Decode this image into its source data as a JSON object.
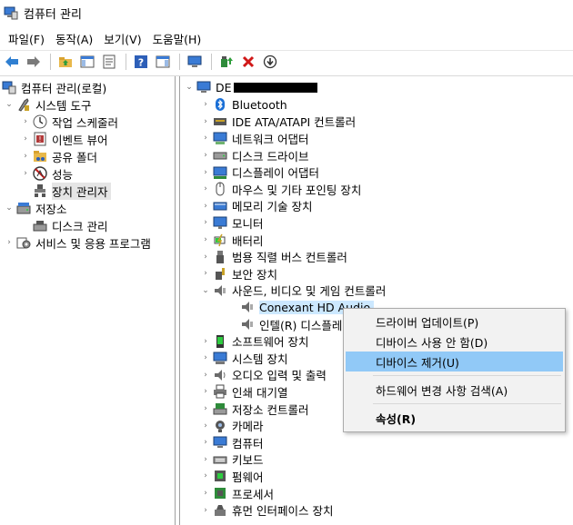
{
  "window": {
    "title": "컴퓨터 관리"
  },
  "menu": [
    "파일(F)",
    "동작(A)",
    "보기(V)",
    "도움말(H)"
  ],
  "left_tree": [
    {
      "label": "컴퓨터 관리(로컬)",
      "icon": "computer-management-icon",
      "level": 0,
      "arrow": ""
    },
    {
      "label": "시스템 도구",
      "icon": "system-tools-icon",
      "level": 1,
      "arrow": "v"
    },
    {
      "label": "작업 스케줄러",
      "icon": "clock-icon",
      "level": 2,
      "arrow": ">"
    },
    {
      "label": "이벤트 뷰어",
      "icon": "event-viewer-icon",
      "level": 2,
      "arrow": ">"
    },
    {
      "label": "공유 폴더",
      "icon": "shared-folder-icon",
      "level": 2,
      "arrow": ">"
    },
    {
      "label": "성능",
      "icon": "performance-icon",
      "level": 2,
      "arrow": ">"
    },
    {
      "label": "장치 관리자",
      "icon": "device-manager-icon",
      "level": 2,
      "arrow": "",
      "selected": true
    },
    {
      "label": "저장소",
      "icon": "storage-icon",
      "level": 1,
      "arrow": "v"
    },
    {
      "label": "디스크 관리",
      "icon": "disk-management-icon",
      "level": 2,
      "arrow": ""
    },
    {
      "label": "서비스 및 응용 프로그램",
      "icon": "services-icon",
      "level": 1,
      "arrow": ">"
    }
  ],
  "device_tree": {
    "root_label": "DE",
    "categories": [
      {
        "label": "Bluetooth",
        "icon": "bluetooth-icon"
      },
      {
        "label": "IDE ATA/ATAPI 컨트롤러",
        "icon": "ide-controller-icon"
      },
      {
        "label": "네트워크 어댑터",
        "icon": "network-adapter-icon"
      },
      {
        "label": "디스크 드라이브",
        "icon": "disk-drive-icon"
      },
      {
        "label": "디스플레이 어댑터",
        "icon": "display-adapter-icon"
      },
      {
        "label": "마우스 및 기타 포인팅 장치",
        "icon": "mouse-icon"
      },
      {
        "label": "메모리 기술 장치",
        "icon": "memory-icon"
      },
      {
        "label": "모니터",
        "icon": "monitor-icon"
      },
      {
        "label": "배터리",
        "icon": "battery-icon"
      },
      {
        "label": "범용 직렬 버스 컨트롤러",
        "icon": "usb-icon"
      },
      {
        "label": "보안 장치",
        "icon": "security-device-icon"
      },
      {
        "label": "사운드, 비디오 및 게임 컨트롤러",
        "icon": "sound-icon",
        "expanded": true
      }
    ],
    "sound_children": [
      {
        "label": "Conexant HD Audio",
        "icon": "speaker-icon",
        "selected": true
      },
      {
        "label": "인텔(R) 디스플레",
        "icon": "speaker-icon"
      }
    ],
    "more_categories": [
      {
        "label": "소프트웨어 장치",
        "icon": "software-device-icon"
      },
      {
        "label": "시스템 장치",
        "icon": "system-device-icon"
      },
      {
        "label": "오디오 입력 및 출력",
        "icon": "audio-io-icon"
      },
      {
        "label": "인쇄 대기열",
        "icon": "printer-icon"
      },
      {
        "label": "저장소 컨트롤러",
        "icon": "storage-controller-icon"
      },
      {
        "label": "카메라",
        "icon": "camera-icon"
      },
      {
        "label": "컴퓨터",
        "icon": "computer-icon"
      },
      {
        "label": "키보드",
        "icon": "keyboard-icon"
      },
      {
        "label": "펌웨어",
        "icon": "firmware-icon"
      },
      {
        "label": "프로세서",
        "icon": "processor-icon"
      },
      {
        "label": "휴먼 인터페이스 장치",
        "icon": "hid-icon"
      }
    ]
  },
  "context_menu": {
    "items": [
      "드라이버 업데이트(P)",
      "디바이스 사용 안 함(D)",
      "디바이스 제거(U)",
      "하드웨어 변경 사항 검색(A)",
      "속성(R)"
    ],
    "hovered_index": 2
  },
  "colors": {
    "hover": "#91c9f7",
    "selection": "#cce8ff",
    "accent": "#0078d7"
  }
}
